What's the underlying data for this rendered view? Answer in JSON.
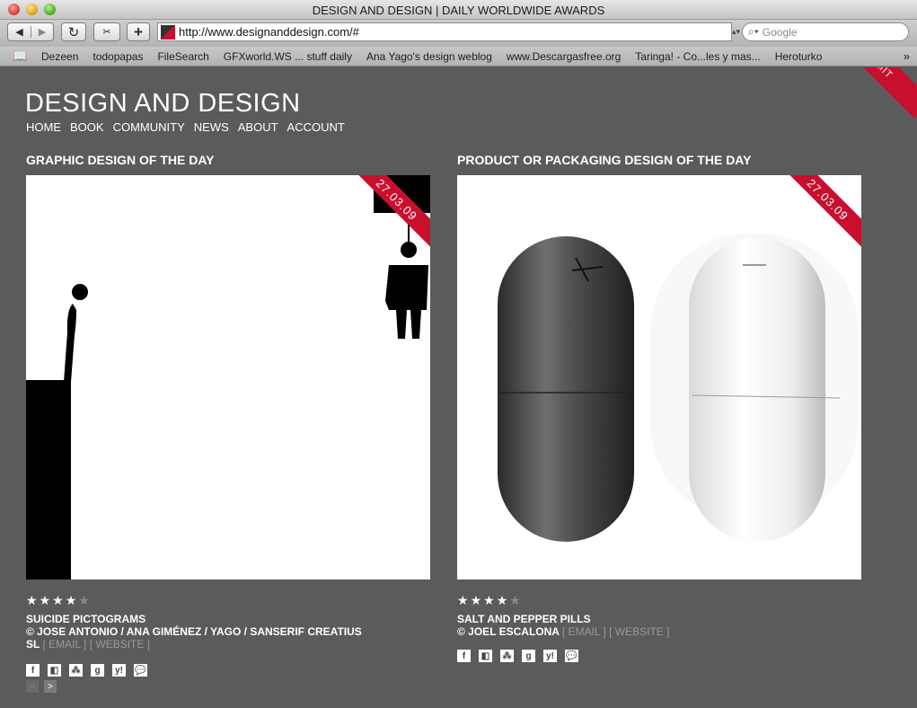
{
  "window": {
    "title": "DESIGN AND DESIGN | DAILY WORLDWIDE AWARDS"
  },
  "toolbar": {
    "back_label": "◀",
    "forward_label": "▶",
    "reload_label": "↻",
    "snip_label": "✂",
    "add_label": "+",
    "url": "http://www.designanddesign.com/#",
    "search_placeholder": "Google"
  },
  "bookmarks": [
    "Dezeen",
    "todopapas",
    "FileSearch",
    "GFXworld.WS ... stuff daily",
    "Ana Yago's design weblog",
    "www.Descargasfree.org",
    "Taringa! - Co...les y mas...",
    "Heroturko"
  ],
  "site": {
    "logo": "DESIGN AND DESIGN",
    "nav": [
      "HOME",
      "BOOK",
      "COMMUNITY",
      "NEWS",
      "ABOUT",
      "ACCOUNT"
    ],
    "submit_label": "SUBMIT"
  },
  "left": {
    "section_title": "GRAPHIC DESIGN OF THE DAY",
    "date": "27.03.09",
    "rating": 4,
    "rating_max": 5,
    "title": "SUICIDE PICTOGRAMS",
    "credit": "© JOSE ANTONIO / ANA GIMÉNEZ / YAGO / SANSERIF CREATIUS SL",
    "email_label": "[ EMAIL ]",
    "website_label": "[ WEBSITE ]",
    "pager_prev": "<",
    "pager_next": ">"
  },
  "right": {
    "section_title": "PRODUCT OR PACKAGING DESIGN OF THE DAY",
    "date": "27.03.09",
    "rating": 4.5,
    "rating_max": 5,
    "title": "SALT AND PEPPER PILLS",
    "credit": "© JOEL ESCALONA",
    "email_label": "[ EMAIL ]",
    "website_label": "[ WEBSITE ]"
  },
  "share_icons": [
    "facebook-icon",
    "delicious-icon",
    "digg-icon",
    "google-icon",
    "yahoo-icon",
    "comment-icon"
  ],
  "colors": {
    "background": "#5b5b5b",
    "accent": "#c8102e"
  }
}
